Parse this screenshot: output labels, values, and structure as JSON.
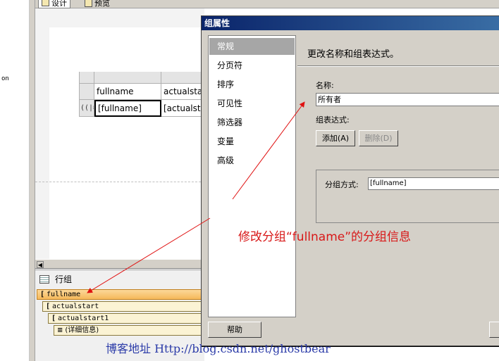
{
  "left_strip": {
    "fragment": "on"
  },
  "tabs": [
    {
      "label": "设计"
    },
    {
      "label": "预览"
    }
  ],
  "tablix": {
    "header_cells": [
      "fullname",
      "actualsta"
    ],
    "detail_cells": [
      "[fullname]",
      "[actualsta"
    ],
    "group_marker": "((|≡"
  },
  "row_groups": {
    "title": "行组",
    "items": [
      {
        "bracket": "[",
        "label": "fullname"
      },
      {
        "bracket": "[",
        "label": "actualstart"
      },
      {
        "bracket": "[",
        "label": "actualstart1"
      },
      {
        "bracket": "≡",
        "label": "(详细信息)"
      }
    ]
  },
  "dialog": {
    "title": "组属性",
    "nav_items": [
      "常规",
      "分页符",
      "排序",
      "可见性",
      "筛选器",
      "变量",
      "高级"
    ],
    "active_nav": "常规",
    "content_title": "更改名称和组表达式。",
    "name_label": "名称:",
    "name_value": "所有者",
    "group_expr_label": "组表达式:",
    "add_button": "添加(A)",
    "delete_button": "删除(D)",
    "group_by_label": "分组方式:",
    "group_by_value": "[fullname]",
    "help_button": "帮助"
  },
  "annotation": {
    "text": "修改分组“fullname”的分组信息",
    "color": "#d81818"
  },
  "watermark": "博客地址 Http://blog.csdn.net/ghostbear"
}
